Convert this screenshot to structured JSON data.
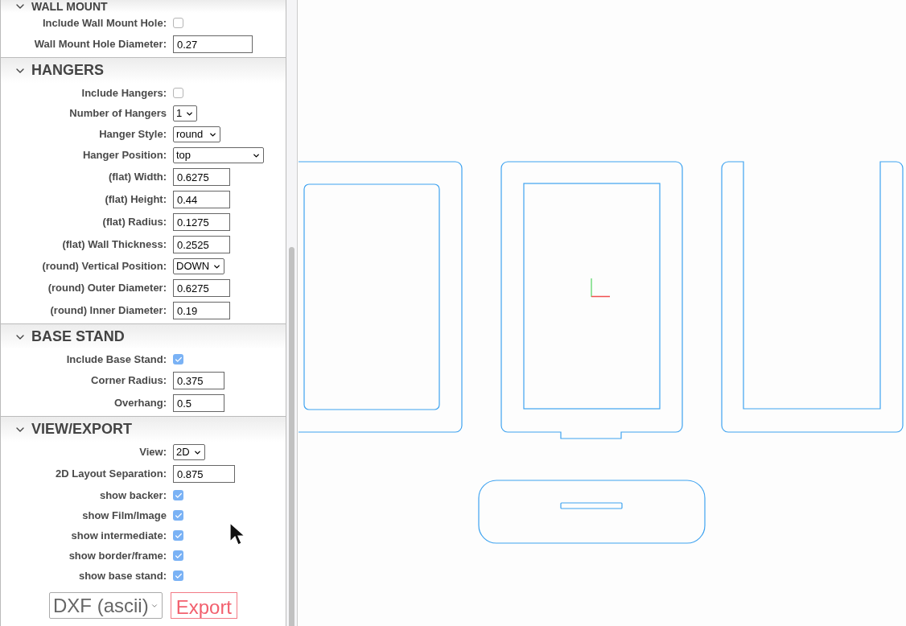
{
  "sections": [
    {
      "title": "WALL MOUNT",
      "expanded": true,
      "fields": [
        {
          "kind": "checkbox",
          "label": "Include Wall Mount Hole:",
          "checked": false
        },
        {
          "kind": "text",
          "label": "Wall Mount Hole Diameter:",
          "value": "0.27"
        }
      ]
    },
    {
      "title": "HANGERS",
      "expanded": true,
      "fields": [
        {
          "kind": "checkbox",
          "label": "Include Hangers:",
          "checked": false
        },
        {
          "kind": "select",
          "label": "Number of Hangers",
          "value": "1"
        },
        {
          "kind": "select",
          "label": "Hanger Style:",
          "value": "round"
        },
        {
          "kind": "select",
          "label": "Hanger Position:",
          "value": "top"
        },
        {
          "kind": "text",
          "label": "(flat) Width:",
          "value": "0.6275"
        },
        {
          "kind": "text",
          "label": "(flat) Height:",
          "value": "0.44"
        },
        {
          "kind": "text",
          "label": "(flat) Radius:",
          "value": "0.1275"
        },
        {
          "kind": "text",
          "label": "(flat) Wall Thickness:",
          "value": "0.2525"
        },
        {
          "kind": "select",
          "label": "(round) Vertical Position:",
          "value": "DOWN"
        },
        {
          "kind": "text",
          "label": "(round) Outer Diameter:",
          "value": "0.6275"
        },
        {
          "kind": "text",
          "label": "(round) Inner Diameter:",
          "value": "0.19"
        }
      ]
    },
    {
      "title": "BASE STAND",
      "expanded": true,
      "fields": [
        {
          "kind": "checkbox",
          "label": "Include Base Stand:",
          "checked": true
        },
        {
          "kind": "text",
          "label": "Corner Radius:",
          "value": "0.375"
        },
        {
          "kind": "text",
          "label": "Overhang:",
          "value": "0.5"
        }
      ]
    },
    {
      "title": "VIEW/EXPORT",
      "expanded": true,
      "fields": [
        {
          "kind": "select",
          "label": "View:",
          "value": "2D"
        },
        {
          "kind": "text",
          "label": "2D Layout Separation:",
          "value": "0.875"
        },
        {
          "kind": "checkbox",
          "label": "show backer:",
          "checked": true
        },
        {
          "kind": "checkbox",
          "label": "show Film/Image",
          "checked": true
        },
        {
          "kind": "checkbox",
          "label": "show intermediate:",
          "checked": true
        },
        {
          "kind": "checkbox",
          "label": "show border/frame:",
          "checked": true
        },
        {
          "kind": "checkbox",
          "label": "show base stand:",
          "checked": true
        }
      ]
    }
  ],
  "export": {
    "format": "DXF (ascii)",
    "button": "Export"
  }
}
